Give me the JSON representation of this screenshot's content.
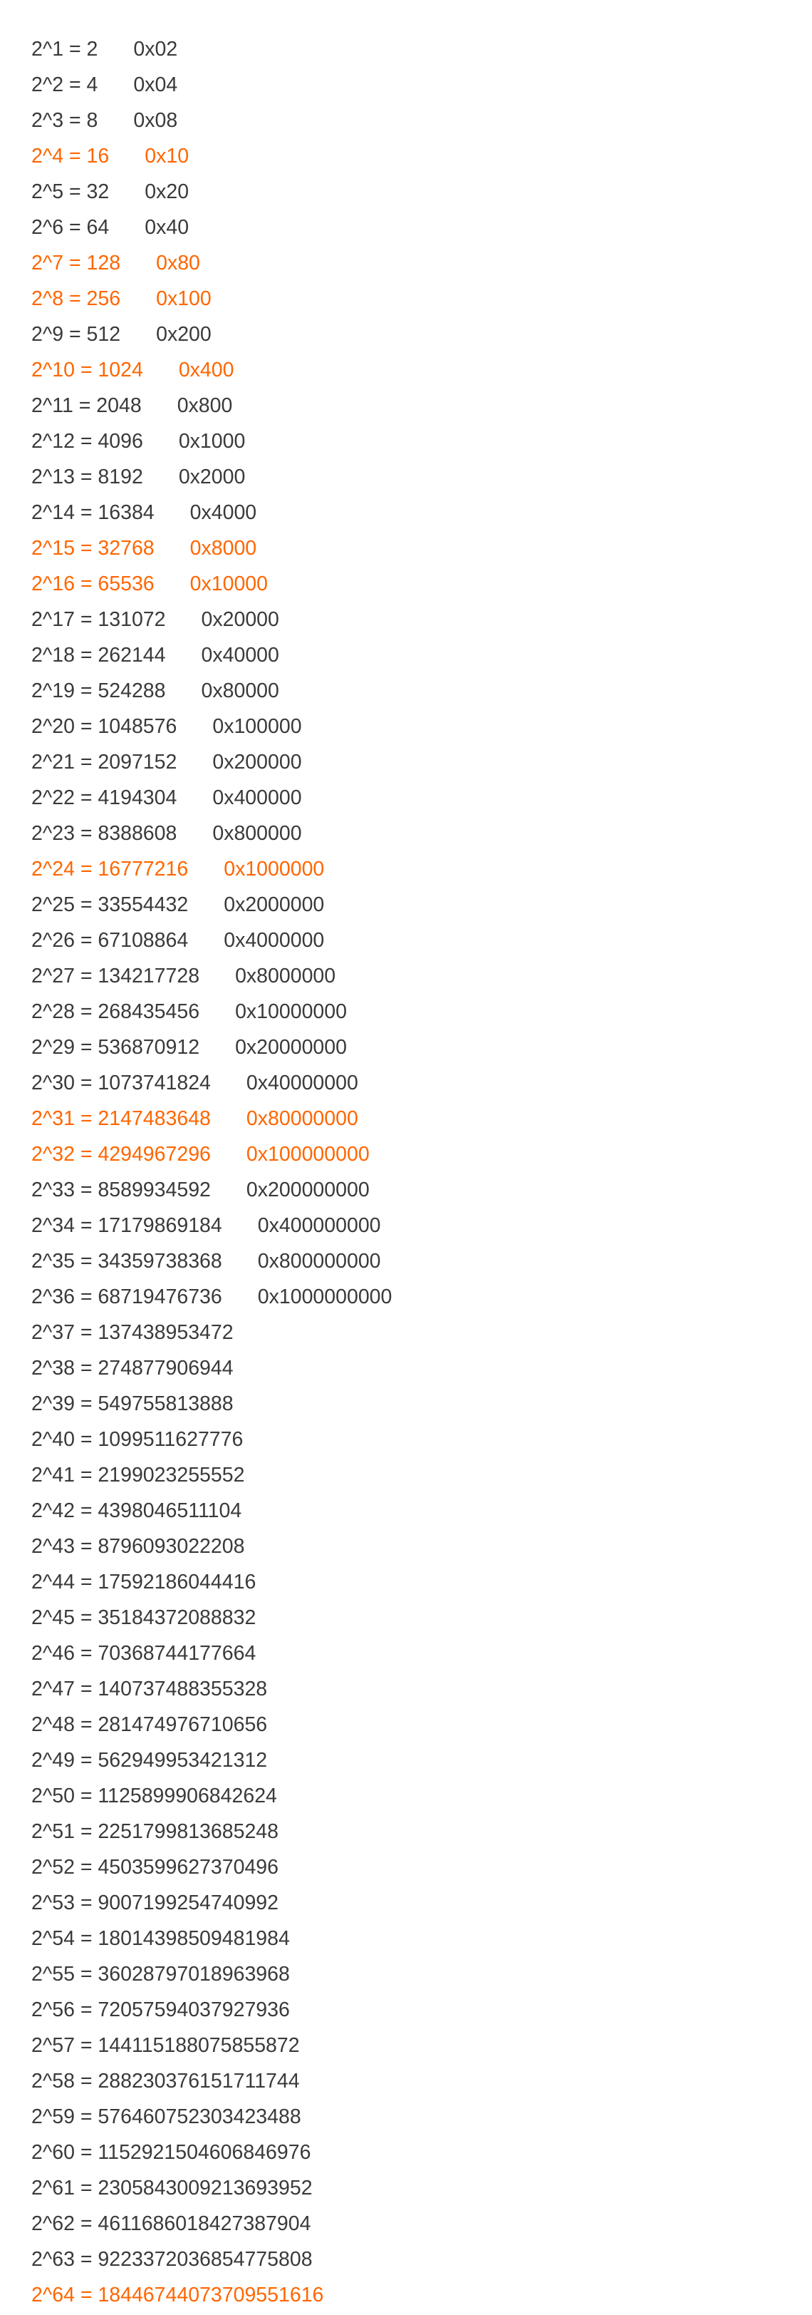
{
  "highlight_color": "#ff6600",
  "text_color": "#3a3a3a",
  "rows": [
    {
      "expr": "2^1 = 2",
      "hex": "0x02",
      "highlight": false
    },
    {
      "expr": "2^2 = 4",
      "hex": "0x04",
      "highlight": false
    },
    {
      "expr": "2^3 = 8",
      "hex": "0x08",
      "highlight": false
    },
    {
      "expr": "2^4 = 16",
      "hex": "0x10",
      "highlight": true
    },
    {
      "expr": "2^5 = 32",
      "hex": "0x20",
      "highlight": false
    },
    {
      "expr": "2^6 = 64",
      "hex": "0x40",
      "highlight": false
    },
    {
      "expr": "2^7 = 128",
      "hex": "0x80",
      "highlight": true
    },
    {
      "expr": "2^8 = 256",
      "hex": "0x100",
      "highlight": true
    },
    {
      "expr": "2^9 = 512",
      "hex": "0x200",
      "highlight": false
    },
    {
      "expr": "2^10 = 1024",
      "hex": "0x400",
      "highlight": true
    },
    {
      "expr": "2^11 = 2048",
      "hex": "0x800",
      "highlight": false
    },
    {
      "expr": "2^12 = 4096",
      "hex": "0x1000",
      "highlight": false
    },
    {
      "expr": "2^13 = 8192",
      "hex": "0x2000",
      "highlight": false
    },
    {
      "expr": "2^14 = 16384",
      "hex": "0x4000",
      "highlight": false
    },
    {
      "expr": "2^15 = 32768",
      "hex": "0x8000",
      "highlight": true
    },
    {
      "expr": "2^16 = 65536",
      "hex": "0x10000",
      "highlight": true
    },
    {
      "expr": "2^17 = 131072",
      "hex": "0x20000",
      "highlight": false
    },
    {
      "expr": "2^18 = 262144",
      "hex": "0x40000",
      "highlight": false
    },
    {
      "expr": "2^19 = 524288",
      "hex": "0x80000",
      "highlight": false
    },
    {
      "expr": "2^20 = 1048576",
      "hex": "0x100000",
      "highlight": false
    },
    {
      "expr": "2^21 = 2097152",
      "hex": "0x200000",
      "highlight": false
    },
    {
      "expr": "2^22 = 4194304",
      "hex": "0x400000",
      "highlight": false
    },
    {
      "expr": "2^23 = 8388608",
      "hex": "0x800000",
      "highlight": false
    },
    {
      "expr": "2^24 = 16777216",
      "hex": "0x1000000",
      "highlight": true
    },
    {
      "expr": "2^25 = 33554432",
      "hex": "0x2000000",
      "highlight": false
    },
    {
      "expr": "2^26 = 67108864",
      "hex": "0x4000000",
      "highlight": false
    },
    {
      "expr": "2^27 = 134217728",
      "hex": "0x8000000",
      "highlight": false
    },
    {
      "expr": "2^28 = 268435456",
      "hex": "0x10000000",
      "highlight": false
    },
    {
      "expr": "2^29 = 536870912",
      "hex": "0x20000000",
      "highlight": false
    },
    {
      "expr": "2^30 = 1073741824",
      "hex": "0x40000000",
      "highlight": false
    },
    {
      "expr": "2^31 = 2147483648",
      "hex": "0x80000000",
      "highlight": true
    },
    {
      "expr": "2^32 = 4294967296",
      "hex": "0x100000000",
      "highlight": true
    },
    {
      "expr": "2^33 = 8589934592",
      "hex": "0x200000000",
      "highlight": false
    },
    {
      "expr": "2^34 = 17179869184",
      "hex": "0x400000000",
      "highlight": false
    },
    {
      "expr": "2^35 = 34359738368",
      "hex": "0x800000000",
      "highlight": false
    },
    {
      "expr": "2^36 = 68719476736",
      "hex": "0x1000000000",
      "highlight": false
    },
    {
      "expr": "2^37 = 137438953472",
      "hex": "",
      "highlight": false
    },
    {
      "expr": "2^38 = 274877906944",
      "hex": "",
      "highlight": false
    },
    {
      "expr": "2^39 = 549755813888",
      "hex": "",
      "highlight": false
    },
    {
      "expr": "2^40 = 1099511627776",
      "hex": "",
      "highlight": false
    },
    {
      "expr": "2^41 = 2199023255552",
      "hex": "",
      "highlight": false
    },
    {
      "expr": "2^42 = 4398046511104",
      "hex": "",
      "highlight": false
    },
    {
      "expr": "2^43 = 8796093022208",
      "hex": "",
      "highlight": false
    },
    {
      "expr": "2^44 = 17592186044416",
      "hex": "",
      "highlight": false
    },
    {
      "expr": "2^45 = 35184372088832",
      "hex": "",
      "highlight": false
    },
    {
      "expr": "2^46 = 70368744177664",
      "hex": "",
      "highlight": false
    },
    {
      "expr": "2^47 = 140737488355328",
      "hex": "",
      "highlight": false
    },
    {
      "expr": "2^48 = 281474976710656",
      "hex": "",
      "highlight": false
    },
    {
      "expr": "2^49 = 562949953421312",
      "hex": "",
      "highlight": false
    },
    {
      "expr": "2^50 = 1125899906842624",
      "hex": "",
      "highlight": false
    },
    {
      "expr": "2^51 = 2251799813685248",
      "hex": "",
      "highlight": false
    },
    {
      "expr": "2^52 = 4503599627370496",
      "hex": "",
      "highlight": false
    },
    {
      "expr": "2^53 = 9007199254740992",
      "hex": "",
      "highlight": false
    },
    {
      "expr": "2^54 = 18014398509481984",
      "hex": "",
      "highlight": false
    },
    {
      "expr": "2^55 = 36028797018963968",
      "hex": "",
      "highlight": false
    },
    {
      "expr": "2^56 = 72057594037927936",
      "hex": "",
      "highlight": false
    },
    {
      "expr": "2^57 = 144115188075855872",
      "hex": "",
      "highlight": false
    },
    {
      "expr": "2^58 = 288230376151711744",
      "hex": "",
      "highlight": false
    },
    {
      "expr": "2^59 = 576460752303423488",
      "hex": "",
      "highlight": false
    },
    {
      "expr": "2^60 = 1152921504606846976",
      "hex": "",
      "highlight": false
    },
    {
      "expr": "2^61 = 2305843009213693952",
      "hex": "",
      "highlight": false
    },
    {
      "expr": "2^62 = 4611686018427387904",
      "hex": "",
      "highlight": false
    },
    {
      "expr": "2^63 = 9223372036854775808",
      "hex": "",
      "highlight": false
    },
    {
      "expr": "2^64 = 18446744073709551616",
      "hex": "",
      "highlight": true
    }
  ]
}
